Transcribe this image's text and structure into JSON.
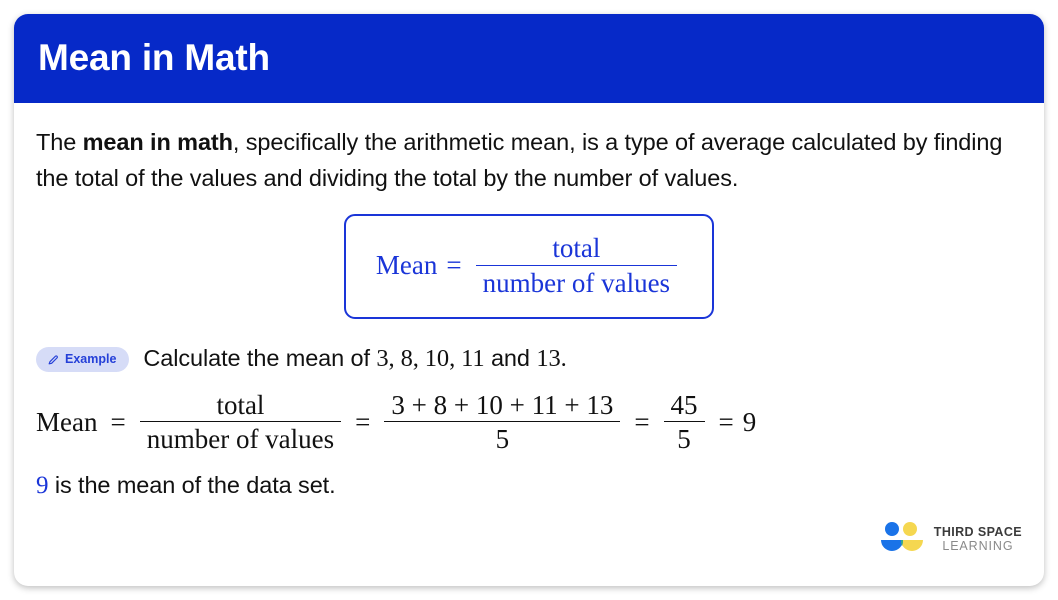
{
  "header": {
    "title": "Mean in Math"
  },
  "intro": {
    "before": "The ",
    "bold": "mean in math",
    "after": ", specifically the arithmetic mean, is a type of average calculated by finding the total of the values and dividing the total by the number of values."
  },
  "formula_box": {
    "label": "Mean",
    "equals": "=",
    "numerator": "total",
    "denominator": "number of values",
    "border_color": "#1a35d8",
    "text_color": "#1a35d8"
  },
  "example": {
    "badge_label": "Example",
    "badge_icon": "pencil-icon",
    "badge_bg": "#d6dcf7",
    "badge_color": "#2540d8",
    "prompt_before": "Calculate the mean of ",
    "prompt_values": "3, 8, 10, 11",
    "prompt_join": " and ",
    "prompt_last": "13",
    "prompt_end": "."
  },
  "solution": {
    "label": "Mean",
    "eq1": "=",
    "frac1_num": "total",
    "frac1_den": "number of values",
    "eq2": "=",
    "frac2_num": "3 + 8 + 10 + 11 + 13",
    "frac2_den": "5",
    "eq3": "=",
    "frac3_num": "45",
    "frac3_den": "5",
    "eq4": "=",
    "result": "9"
  },
  "conclusion": {
    "answer": "9",
    "text": " is the mean of the data set."
  },
  "logo": {
    "top": "THIRD SPACE",
    "bottom": "LEARNING",
    "blue": "#2b7de9",
    "yellow": "#f5d750",
    "teal": "#34a88a",
    "dot_blue": "#1a73e8"
  },
  "chart_data": {
    "type": "table",
    "title": "Mean in Math",
    "dataset": [
      3,
      8,
      10,
      11,
      13
    ],
    "count": 5,
    "total": 45,
    "mean": 9
  }
}
